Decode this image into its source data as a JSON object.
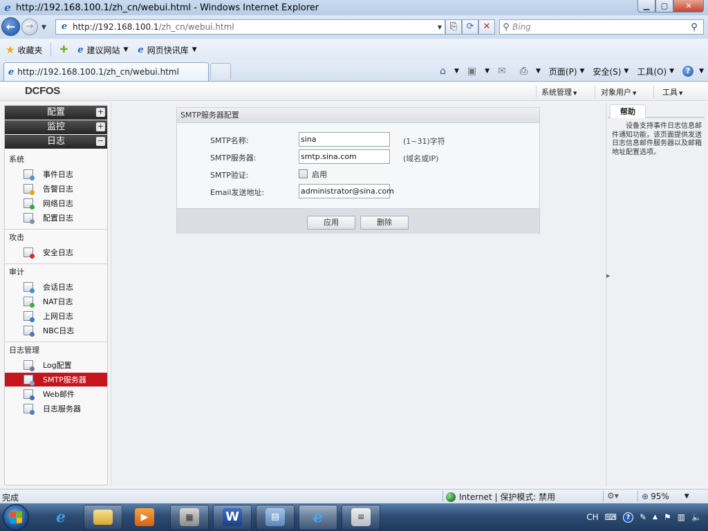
{
  "browser": {
    "title": "http://192.168.100.1/zh_cn/webui.html - Windows Internet Explorer",
    "address": {
      "host": "http://192.168.100.1",
      "path": "/zh_cn/webui.html"
    },
    "search_placeholder": "Bing",
    "favorites_label": "收藏夹",
    "favorites_links": [
      "建议网站",
      "网页快讯库"
    ],
    "active_tab": "http://192.168.100.1/zh_cn/webui.html",
    "commands": {
      "page": "页面(P)",
      "safety": "安全(S)",
      "tools": "工具(O)"
    },
    "status": {
      "done": "完成",
      "zone": "Internet | 保护模式: 禁用",
      "zoom": "95%"
    }
  },
  "app": {
    "logo": "DCFOS",
    "top_menu": [
      "系统管理",
      "对象用户",
      "工具"
    ],
    "sidebar": {
      "categories": [
        {
          "label": "配置",
          "toggle": "+"
        },
        {
          "label": "监控",
          "toggle": "+"
        },
        {
          "label": "日志",
          "toggle": "−"
        }
      ],
      "groups": [
        {
          "label": "系统",
          "items": [
            "事件日志",
            "告警日志",
            "网络日志",
            "配置日志"
          ]
        },
        {
          "label": "攻击",
          "items": [
            "安全日志"
          ]
        },
        {
          "label": "审计",
          "items": [
            "会话日志",
            "NAT日志",
            "上网日志",
            "NBC日志"
          ]
        },
        {
          "label": "日志管理",
          "items": [
            "Log配置",
            "SMTP服务器",
            "Web邮件",
            "日志服务器"
          ]
        }
      ],
      "active_item": "SMTP服务器"
    },
    "form": {
      "title": "SMTP服务器配置",
      "fields": [
        {
          "label": "SMTP名称:",
          "value": "sina",
          "hint": "(1~31)字符"
        },
        {
          "label": "SMTP服务器:",
          "value": "smtp.sina.com",
          "hint": "(域名或IP)"
        },
        {
          "label": "SMTP验证:",
          "checkbox_label": "启用",
          "checked": false
        },
        {
          "label": "Email发送地址:",
          "value": "administrator@sina.com"
        }
      ],
      "apply_label": "应用",
      "delete_label": "删除"
    },
    "help": {
      "tab": "帮助",
      "text": "设备支持事件日志信息邮件通知功能，该页面提供发送日志信息邮件服务器以及邮箱地址配置选项。"
    }
  },
  "taskbar": {
    "tray": {
      "lang": "CH"
    }
  },
  "colors": {
    "active_nav": "#c8141c",
    "category_bar": "#2f2f2f",
    "ie_frame": "#c8daee"
  }
}
